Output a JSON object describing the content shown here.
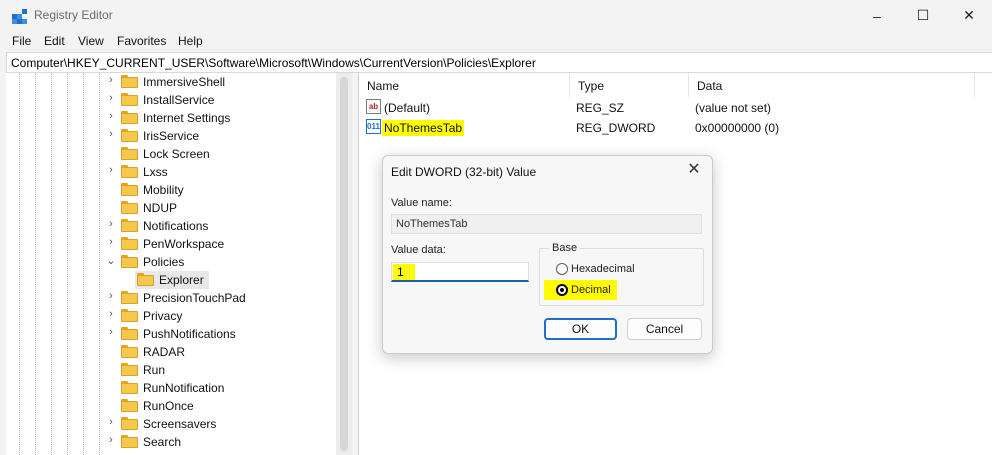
{
  "window": {
    "title": "Registry Editor",
    "app_icon": "registry-icon",
    "controls": {
      "minimize": "–",
      "maximize": "☐",
      "close": "✕"
    }
  },
  "menu": [
    "File",
    "Edit",
    "View",
    "Favorites",
    "Help"
  ],
  "address": "Computer\\HKEY_CURRENT_USER\\Software\\Microsoft\\Windows\\CurrentVersion\\Policies\\Explorer",
  "tree": {
    "items": [
      {
        "label": "ImmersiveShell",
        "chevron": "›"
      },
      {
        "label": "InstallService",
        "chevron": "›"
      },
      {
        "label": "Internet Settings",
        "chevron": "›"
      },
      {
        "label": "IrisService",
        "chevron": "›"
      },
      {
        "label": "Lock Screen",
        "chevron": ""
      },
      {
        "label": "Lxss",
        "chevron": "›"
      },
      {
        "label": "Mobility",
        "chevron": ""
      },
      {
        "label": "NDUP",
        "chevron": ""
      },
      {
        "label": "Notifications",
        "chevron": "›"
      },
      {
        "label": "PenWorkspace",
        "chevron": "›"
      },
      {
        "label": "Policies",
        "chevron": "⌄"
      },
      {
        "label": "Explorer",
        "chevron": ""
      },
      {
        "label": "PrecisionTouchPad",
        "chevron": "›"
      },
      {
        "label": "Privacy",
        "chevron": "›"
      },
      {
        "label": "PushNotifications",
        "chevron": "›"
      },
      {
        "label": "RADAR",
        "chevron": ""
      },
      {
        "label": "Run",
        "chevron": ""
      },
      {
        "label": "RunNotification",
        "chevron": ""
      },
      {
        "label": "RunOnce",
        "chevron": ""
      },
      {
        "label": "Screensavers",
        "chevron": "›"
      },
      {
        "label": "Search",
        "chevron": "›"
      }
    ],
    "selected": "Explorer"
  },
  "list": {
    "columns": [
      "Name",
      "Type",
      "Data"
    ],
    "rows": [
      {
        "name": "(Default)",
        "type": "REG_SZ",
        "data": "(value not set)",
        "icon": "string-value-icon",
        "icon_glyph": "ab"
      },
      {
        "name": "NoThemesTab",
        "type": "REG_DWORD",
        "data": "0x00000000 (0)",
        "icon": "dword-value-icon",
        "icon_glyph": "011"
      }
    ]
  },
  "dialog": {
    "title": "Edit DWORD (32-bit) Value",
    "value_name_label": "Value name:",
    "value_name": "NoThemesTab",
    "value_data_label": "Value data:",
    "value_data": "1",
    "base_label": "Base",
    "base_options": [
      "Hexadecimal",
      "Decimal"
    ],
    "base_selected": "Decimal",
    "ok_label": "OK",
    "cancel_label": "Cancel",
    "close_glyph": "✕"
  },
  "colors": {
    "highlight": "#fffb00",
    "accent": "#1f6fc8"
  }
}
